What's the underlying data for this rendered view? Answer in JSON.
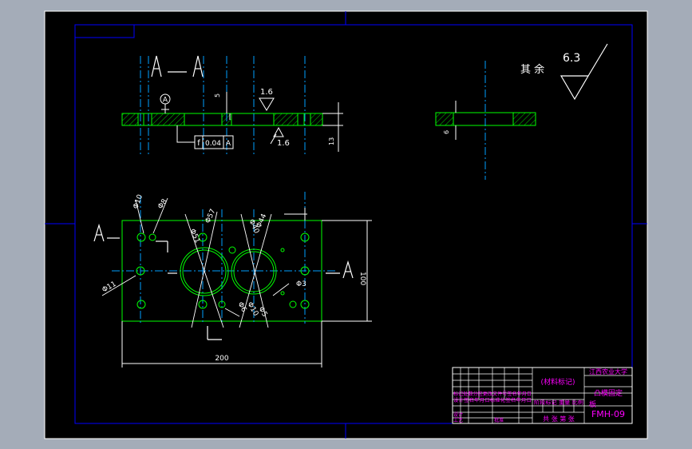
{
  "colors": {
    "background": "#a4acb8",
    "paper": "#000000",
    "frame": "#ffffff",
    "border": "#0000ff",
    "outline": "#00ff00",
    "centerline": "#00a0ff",
    "dimension": "#ffffff",
    "table_text": "#ff00ff",
    "table_line": "#ffffff"
  },
  "sections": {
    "top_label_left": "A",
    "top_label_dash": "—",
    "top_label_right": "A",
    "left_arrow_label": "A",
    "right_arrow_label": "A"
  },
  "surface_finish": {
    "rest_label": "其 余",
    "rest_value": "6.3",
    "top_value": "1.6",
    "bottom_value": "1.6"
  },
  "tolerance": {
    "datum": "A",
    "symbol": "f",
    "value": "0.04",
    "ref": "A"
  },
  "dimensions": {
    "d5": "5",
    "d13": "13",
    "d6": "6",
    "phi10": "Φ10",
    "phi8": "Φ8",
    "phi51": "Φ51",
    "phi57": "Φ57",
    "phi40": "Φ40",
    "phi44": "Φ44",
    "phi11": "Φ11",
    "phi3": "Φ3",
    "phi5": "Φ5",
    "phi6": "Φ6",
    "phi10b": "Φ10",
    "height": "100",
    "width": "200"
  },
  "title_block": {
    "material_mark": "(材料标记)",
    "school": "江西农业大学",
    "part_name_1": "凸模固定",
    "part_name_2": "板",
    "drawing_no": "FMH-09",
    "scale_row": "共 张 第 张",
    "design_label": "设计",
    "process_label": "工艺",
    "approve_label": "批准",
    "row_a": "标记处数分区更改文件号签名年月日",
    "row_b": "设计签名年月日标准化签名年月日",
    "stage_labels": "阶段标记 重量 比例"
  }
}
